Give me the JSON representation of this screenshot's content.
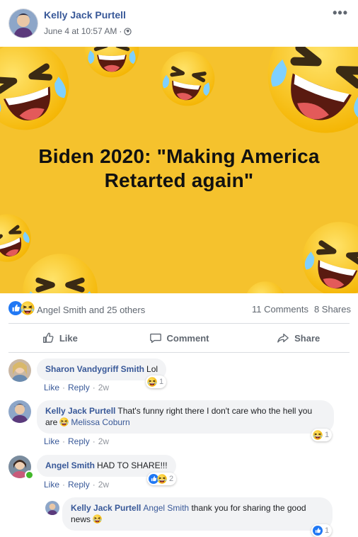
{
  "post": {
    "author": "Kelly Jack Purtell",
    "timestamp": "June 4 at 10:57 AM",
    "separator": "·",
    "more": "•••",
    "image_text_line1": "Biden 2020: \"Making America",
    "image_text_line2": "Retarted again\"",
    "reactions_names": "Angel Smith and 25 others",
    "comments_count": "11 Comments",
    "shares_count": "8 Shares"
  },
  "actions": {
    "like": "Like",
    "comment": "Comment",
    "share": "Share"
  },
  "comments": [
    {
      "name": "Sharon Vandygriff Smith",
      "text": "Lol",
      "like": "Like",
      "reply": "Reply",
      "time": "2w",
      "reaction_count": "1"
    },
    {
      "name": "Kelly Jack Purtell",
      "text": "That's funny right there I don't care who the hell you are",
      "mention": "Melissa Coburn",
      "like": "Like",
      "reply": "Reply",
      "time": "2w",
      "reaction_count": "1"
    },
    {
      "name": "Angel Smith",
      "text": "HAD TO SHARE!!!",
      "like": "Like",
      "reply": "Reply",
      "time": "2w",
      "reaction_count": "2"
    },
    {
      "name": "Kelly Jack Purtell",
      "mention": "Angel Smith",
      "text": "thank you for sharing the good news",
      "reaction_count": "1"
    }
  ],
  "colors": {
    "link": "#385898",
    "image_bg": "#f5c22d",
    "bubble_bg": "#f2f3f5",
    "like_blue": "#2078f4"
  }
}
